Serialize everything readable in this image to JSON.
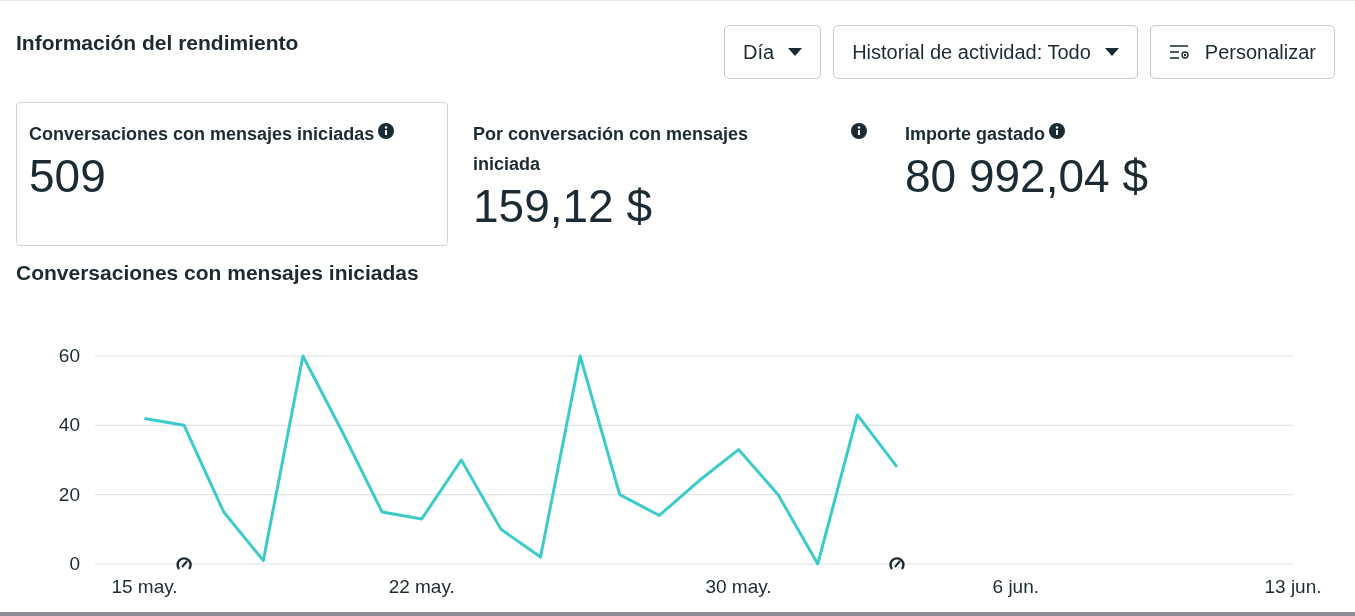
{
  "header": {
    "title": "Información del rendimiento",
    "controls": [
      {
        "kind": "dropdown",
        "label": "Día"
      },
      {
        "kind": "dropdown",
        "label": "Historial de actividad: Todo"
      },
      {
        "kind": "button",
        "label": "Personalizar"
      }
    ]
  },
  "metrics": [
    {
      "label": "Conversaciones con mensajes iniciadas",
      "value": "509",
      "selected": true
    },
    {
      "label": "Por conversación con mensajes iniciada",
      "value": "159,12 $",
      "selected": false
    },
    {
      "label": "Importe gastado",
      "value": "80 992,04 $",
      "selected": false
    }
  ],
  "chart": {
    "title": "Conversaciones con mensajes iniciadas",
    "chart_data": {
      "type": "line",
      "categories": [
        "15 may.",
        null,
        null,
        null,
        null,
        null,
        null,
        "22 may.",
        null,
        null,
        null,
        null,
        null,
        null,
        null,
        "30 may.",
        null,
        null,
        null,
        null,
        null,
        null,
        "6 jun.",
        null,
        null,
        null,
        null,
        null,
        null,
        "13 jun."
      ],
      "series": [
        {
          "color": "#3ccbcb",
          "values": [
            42,
            40,
            15,
            1,
            60,
            38,
            15,
            13,
            30,
            10,
            2,
            60,
            20,
            14,
            24,
            33,
            20,
            0,
            43,
            28,
            null,
            null,
            null,
            null,
            null,
            null,
            null,
            null,
            null,
            null
          ]
        }
      ],
      "ylim": [
        0,
        60
      ],
      "yticks": [
        0,
        20,
        40,
        60
      ],
      "grid": true
    }
  }
}
